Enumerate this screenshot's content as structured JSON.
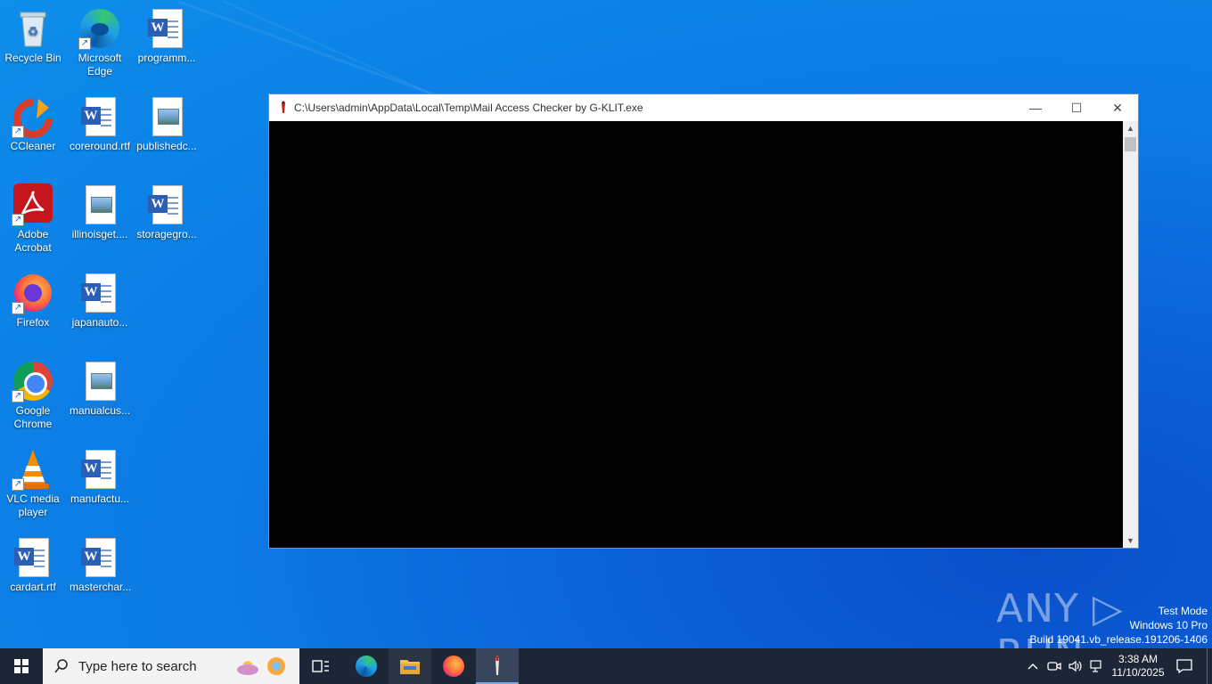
{
  "desktop": {
    "icons": [
      {
        "label": "Recycle Bin"
      },
      {
        "label": "Microsoft Edge"
      },
      {
        "label": "programm..."
      },
      {
        "label": "CCleaner"
      },
      {
        "label": "coreround.rtf"
      },
      {
        "label": "publishedc..."
      },
      {
        "label": "Adobe Acrobat"
      },
      {
        "label": "illinoisget...."
      },
      {
        "label": "storagegro..."
      },
      {
        "label": "Firefox"
      },
      {
        "label": "japanauto..."
      },
      {
        "label": "Google Chrome"
      },
      {
        "label": "manualcus..."
      },
      {
        "label": "VLC media player"
      },
      {
        "label": "manufactu..."
      },
      {
        "label": "cardart.rtf"
      },
      {
        "label": "masterchar..."
      }
    ]
  },
  "window": {
    "title": "C:\\Users\\admin\\AppData\\Local\\Temp\\Mail Access Checker by G-KLIT.exe",
    "minimize": "—",
    "maximize": "☐",
    "close": "✕",
    "console_bg": "#000000"
  },
  "watermark": {
    "brand": "ANY ▷ RUN",
    "mode": "Test Mode",
    "edition": "Windows 10 Pro",
    "build": "Build 19041.vb_release.191206-1406"
  },
  "taskbar": {
    "search_placeholder": "Type here to search",
    "time": "3:38 AM",
    "date": "11/10/2025"
  }
}
